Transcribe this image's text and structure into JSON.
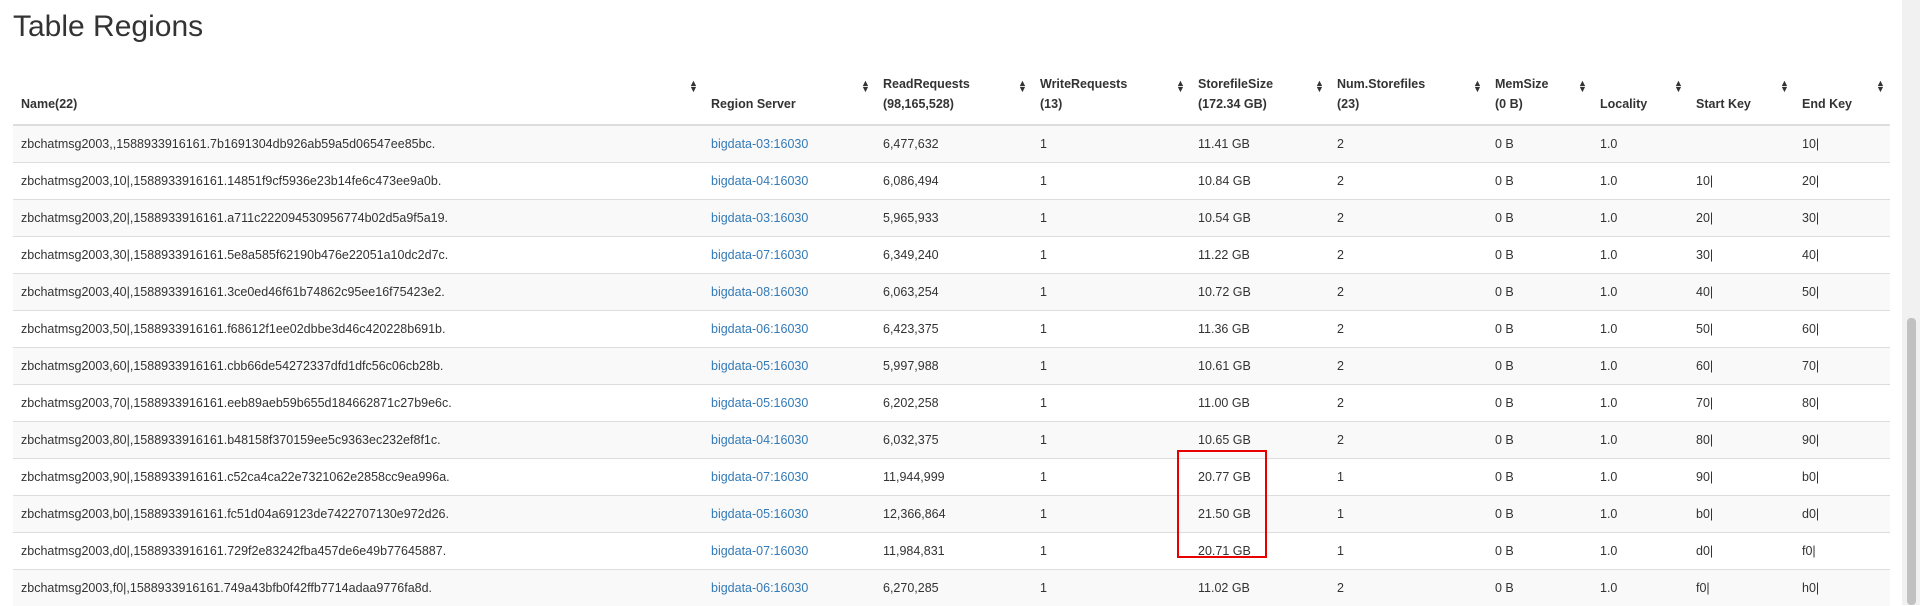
{
  "page": {
    "title": "Table Regions"
  },
  "columns": [
    {
      "label": "Name(22)",
      "sub": ""
    },
    {
      "label": "Region Server",
      "sub": ""
    },
    {
      "label": "ReadRequests",
      "sub": "(98,165,528)"
    },
    {
      "label": "WriteRequests",
      "sub": "(13)"
    },
    {
      "label": "StorefileSize",
      "sub": "(172.34 GB)"
    },
    {
      "label": "Num.Storefiles",
      "sub": "(23)"
    },
    {
      "label": "MemSize",
      "sub": "(0 B)"
    },
    {
      "label": "Locality",
      "sub": ""
    },
    {
      "label": "Start Key",
      "sub": ""
    },
    {
      "label": "End Key",
      "sub": ""
    }
  ],
  "sort_icon": "sort-both-icon",
  "rows": [
    {
      "name": "zbchatmsg2003,,1588933916161.7b1691304db926ab59a5d06547ee85bc.",
      "server": "bigdata-03:16030",
      "read": "6,477,632",
      "write": "1",
      "size": "11.41 GB",
      "files": "2",
      "mem": "0 B",
      "locality": "1.0",
      "start": "",
      "end": "10|"
    },
    {
      "name": "zbchatmsg2003,10|,1588933916161.14851f9cf5936e23b14fe6c473ee9a0b.",
      "server": "bigdata-04:16030",
      "read": "6,086,494",
      "write": "1",
      "size": "10.84 GB",
      "files": "2",
      "mem": "0 B",
      "locality": "1.0",
      "start": "10|",
      "end": "20|"
    },
    {
      "name": "zbchatmsg2003,20|,1588933916161.a711c222094530956774b02d5a9f5a19.",
      "server": "bigdata-03:16030",
      "read": "5,965,933",
      "write": "1",
      "size": "10.54 GB",
      "files": "2",
      "mem": "0 B",
      "locality": "1.0",
      "start": "20|",
      "end": "30|"
    },
    {
      "name": "zbchatmsg2003,30|,1588933916161.5e8a585f62190b476e22051a10dc2d7c.",
      "server": "bigdata-07:16030",
      "read": "6,349,240",
      "write": "1",
      "size": "11.22 GB",
      "files": "2",
      "mem": "0 B",
      "locality": "1.0",
      "start": "30|",
      "end": "40|"
    },
    {
      "name": "zbchatmsg2003,40|,1588933916161.3ce0ed46f61b74862c95ee16f75423e2.",
      "server": "bigdata-08:16030",
      "read": "6,063,254",
      "write": "1",
      "size": "10.72 GB",
      "files": "2",
      "mem": "0 B",
      "locality": "1.0",
      "start": "40|",
      "end": "50|"
    },
    {
      "name": "zbchatmsg2003,50|,1588933916161.f68612f1ee02dbbe3d46c420228b691b.",
      "server": "bigdata-06:16030",
      "read": "6,423,375",
      "write": "1",
      "size": "11.36 GB",
      "files": "2",
      "mem": "0 B",
      "locality": "1.0",
      "start": "50|",
      "end": "60|"
    },
    {
      "name": "zbchatmsg2003,60|,1588933916161.cbb66de54272337dfd1dfc56c06cb28b.",
      "server": "bigdata-05:16030",
      "read": "5,997,988",
      "write": "1",
      "size": "10.61 GB",
      "files": "2",
      "mem": "0 B",
      "locality": "1.0",
      "start": "60|",
      "end": "70|"
    },
    {
      "name": "zbchatmsg2003,70|,1588933916161.eeb89aeb59b655d184662871c27b9e6c.",
      "server": "bigdata-05:16030",
      "read": "6,202,258",
      "write": "1",
      "size": "11.00 GB",
      "files": "2",
      "mem": "0 B",
      "locality": "1.0",
      "start": "70|",
      "end": "80|"
    },
    {
      "name": "zbchatmsg2003,80|,1588933916161.b48158f370159ee5c9363ec232ef8f1c.",
      "server": "bigdata-04:16030",
      "read": "6,032,375",
      "write": "1",
      "size": "10.65 GB",
      "files": "2",
      "mem": "0 B",
      "locality": "1.0",
      "start": "80|",
      "end": "90|"
    },
    {
      "name": "zbchatmsg2003,90|,1588933916161.c52ca4ca22e7321062e2858cc9ea996a.",
      "server": "bigdata-07:16030",
      "read": "11,944,999",
      "write": "1",
      "size": "20.77 GB",
      "files": "1",
      "mem": "0 B",
      "locality": "1.0",
      "start": "90|",
      "end": "b0|"
    },
    {
      "name": "zbchatmsg2003,b0|,1588933916161.fc51d04a69123de7422707130e972d26.",
      "server": "bigdata-05:16030",
      "read": "12,366,864",
      "write": "1",
      "size": "21.50 GB",
      "files": "1",
      "mem": "0 B",
      "locality": "1.0",
      "start": "b0|",
      "end": "d0|"
    },
    {
      "name": "zbchatmsg2003,d0|,1588933916161.729f2e83242fba457de6e49b77645887.",
      "server": "bigdata-07:16030",
      "read": "11,984,831",
      "write": "1",
      "size": "20.71 GB",
      "files": "1",
      "mem": "0 B",
      "locality": "1.0",
      "start": "d0|",
      "end": "f0|"
    },
    {
      "name": "zbchatmsg2003,f0|,1588933916161.749a43bfb0f42ffb7714adaa9776fa8d.",
      "server": "bigdata-06:16030",
      "read": "6,270,285",
      "write": "1",
      "size": "11.02 GB",
      "files": "2",
      "mem": "0 B",
      "locality": "1.0",
      "start": "f0|",
      "end": "h0|"
    }
  ],
  "colors": {
    "link": "#337ab7",
    "highlight": "#e60000",
    "stripe": "#f9f9f9"
  }
}
